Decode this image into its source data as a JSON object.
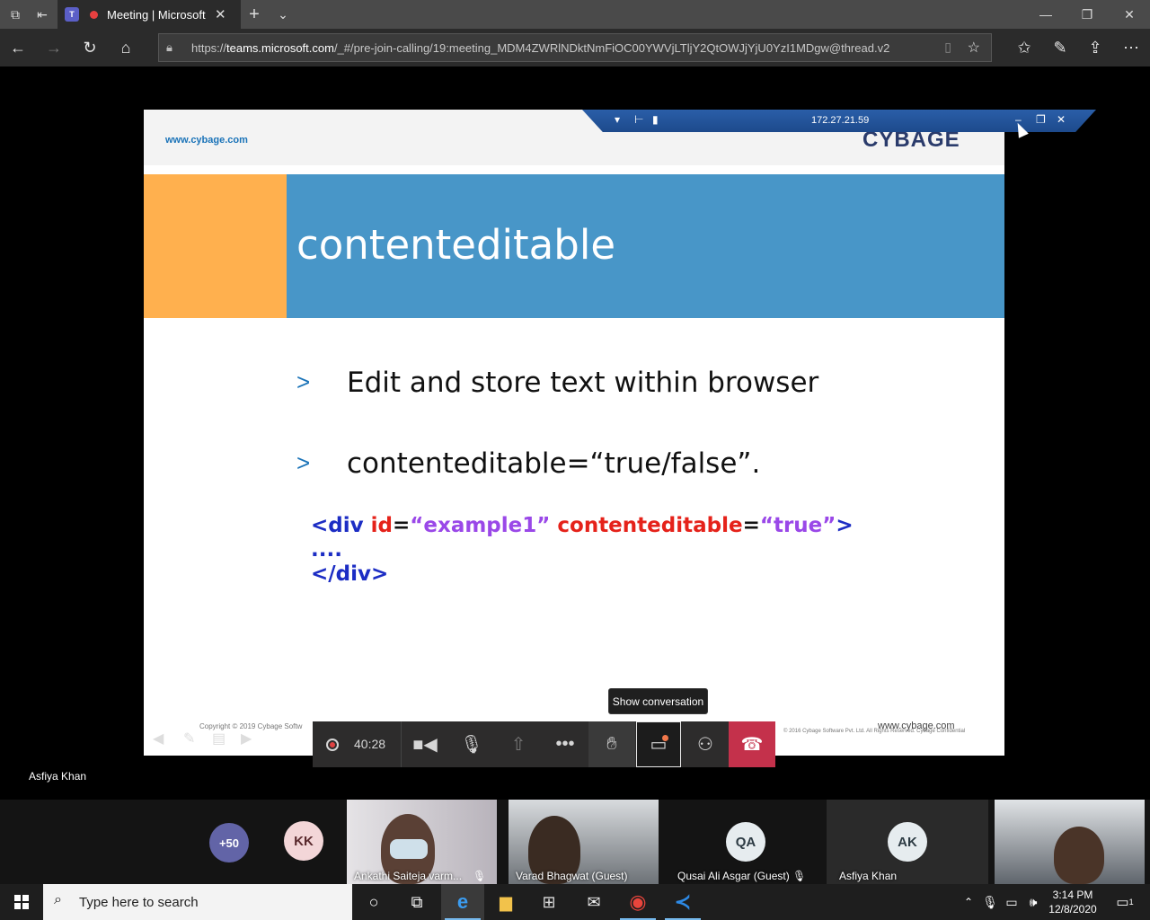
{
  "browser": {
    "tab_title": "Meeting | Microsoft",
    "url_prefix": "https://",
    "url_domain": "teams.microsoft.com",
    "url_path": "/_#/pre-join-calling/19:meeting_MDM4ZWRlNDktNmFiOC00YWVjLTljY2QtOWJjYjU0YzI1MDgw@thread.v2"
  },
  "remote_desktop": {
    "ip": "172.27.21.59"
  },
  "slide": {
    "site_url": "www.cybage.com",
    "logo": "CYBAGE",
    "title": "contenteditable",
    "bullets": [
      {
        "marker": ">",
        "text": "Edit and store text within browser"
      },
      {
        "marker": ">",
        "text": "contenteditable=“true/false”."
      }
    ],
    "code": {
      "open_lt": "<div ",
      "attr1": "id",
      "eq1": "=",
      "val1": "“example1”",
      "attr2": " contenteditable",
      "eq2": "=",
      "val2": "“true”",
      "open_gt": ">",
      "dots": "....",
      "close": "</div>"
    },
    "footer_copyright": "Copyright © 2019 Cybage Softw",
    "footer_copyright_right": "© 2016 Cybage Software Pvt. Ltd. All Rights Reserved. Cybage Confidential",
    "footer_url": "www.cybage.com"
  },
  "meeting": {
    "timer": "40:28",
    "tooltip": "Show conversation",
    "presenter": "Asfiya Khan"
  },
  "participants": {
    "overflow_count": "+50",
    "avatars": [
      {
        "initials": "KK",
        "color": "#f3d6d8",
        "text_color": "#5a2a2e"
      },
      {
        "initials": "QA",
        "color": "#e6ecef",
        "text_color": "#2d3b44",
        "name": "Qusai Ali Asgar (Guest)"
      },
      {
        "initials": "AK",
        "color": "#e6ecef",
        "text_color": "#2d3b44",
        "name": "Asfiya Khan"
      }
    ],
    "video_tiles": [
      {
        "name": "Ankathi Saiteja varm..."
      },
      {
        "name": "Varad Bhagwat (Guest)"
      }
    ]
  },
  "taskbar": {
    "search_placeholder": "Type here to search",
    "time": "3:14 PM",
    "date": "12/8/2020",
    "notification_count": "1"
  }
}
